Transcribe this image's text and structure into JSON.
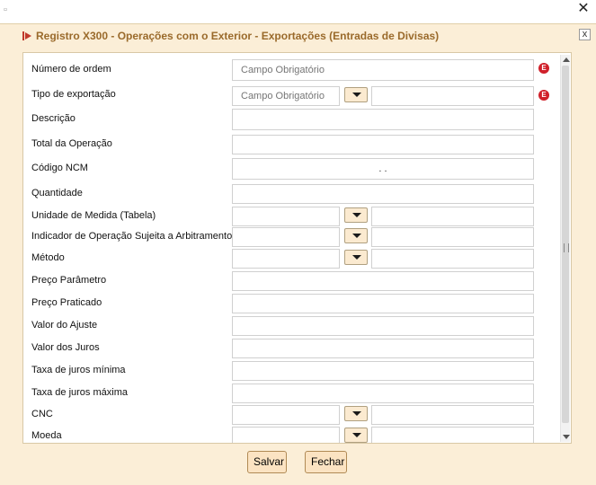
{
  "outer": {
    "close_glyph": "✕",
    "app_icon": "▫"
  },
  "dialog": {
    "title": "Registro X300 - Operações com o Exterior - Exportações (Entradas de Divisas)",
    "close_glyph": "x"
  },
  "required_placeholder": "Campo Obrigatório",
  "required_marker": "E",
  "ncm_mask": ". .",
  "fields": {
    "numero_ordem": {
      "label": "Número de ordem",
      "value": ""
    },
    "tipo_exportacao": {
      "label": "Tipo de exportação",
      "value": "",
      "description": ""
    },
    "descricao": {
      "label": "Descrição",
      "value": ""
    },
    "total_operacao": {
      "label": "Total da Operação",
      "value": ""
    },
    "codigo_ncm": {
      "label": "Código NCM",
      "value": ""
    },
    "quantidade": {
      "label": "Quantidade",
      "value": ""
    },
    "unidade_medida": {
      "label": "Unidade de Medida (Tabela)",
      "value": "",
      "description": ""
    },
    "indicador_arbitramento": {
      "label": "Indicador de Operação Sujeita a Arbitramento",
      "value": "",
      "description": ""
    },
    "metodo": {
      "label": "Método",
      "value": "",
      "description": ""
    },
    "preco_parametro": {
      "label": "Preço Parâmetro",
      "value": ""
    },
    "preco_praticado": {
      "label": "Preço Praticado",
      "value": ""
    },
    "valor_ajuste": {
      "label": "Valor do Ajuste",
      "value": ""
    },
    "valor_juros": {
      "label": "Valor dos Juros",
      "value": ""
    },
    "taxa_juros_minima": {
      "label": "Taxa de juros mínima",
      "value": ""
    },
    "taxa_juros_maxima": {
      "label": "Taxa de juros máxima",
      "value": ""
    },
    "cnc": {
      "label": "CNC",
      "value": "",
      "description": ""
    },
    "moeda": {
      "label": "Moeda",
      "value": "",
      "description": ""
    }
  },
  "buttons": {
    "save": "Salvar",
    "close": "Fechar"
  },
  "colors": {
    "dialog_bg": "#fbeed7",
    "title_text": "#9a6a2b",
    "button_bg": "#fbe3c2",
    "required_icon": "#d0202a"
  }
}
